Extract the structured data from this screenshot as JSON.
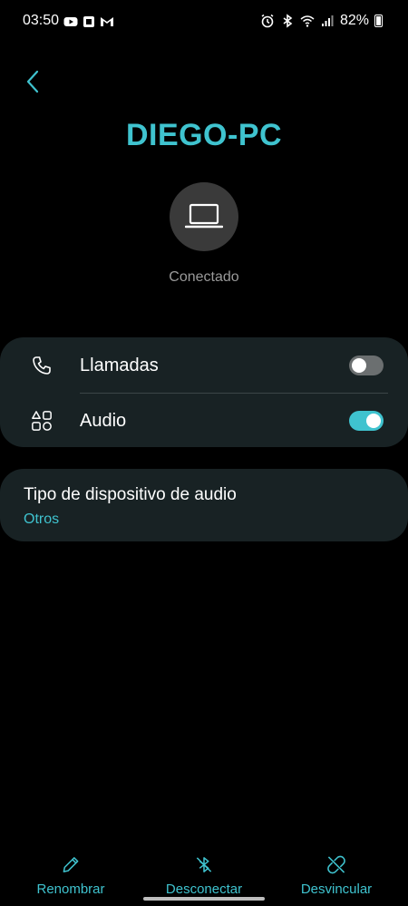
{
  "status_bar": {
    "time": "03:50",
    "left_icons": [
      "youtube-icon",
      "notification-app-icon",
      "gmail-icon"
    ],
    "right_icons": [
      "alarm-icon",
      "bluetooth-icon",
      "wifi-icon",
      "signal-icon"
    ],
    "battery": "82%"
  },
  "device": {
    "name": "DIEGO-PC",
    "icon": "laptop-icon",
    "status": "Conectado"
  },
  "profiles": [
    {
      "label": "Llamadas",
      "icon": "phone-icon",
      "enabled": false
    },
    {
      "label": "Audio",
      "icon": "apps-grid-icon",
      "enabled": true
    }
  ],
  "audio_type": {
    "title": "Tipo de dispositivo de audio",
    "value": "Otros"
  },
  "bottom_actions": [
    {
      "label": "Renombrar",
      "icon": "pencil-icon"
    },
    {
      "label": "Desconectar",
      "icon": "bluetooth-off-icon"
    },
    {
      "label": "Desvincular",
      "icon": "unlink-icon"
    }
  ],
  "colors": {
    "accent": "#3fc3cf",
    "background": "#000000",
    "card": "#182224",
    "toggle_off": "#6b6f70"
  }
}
